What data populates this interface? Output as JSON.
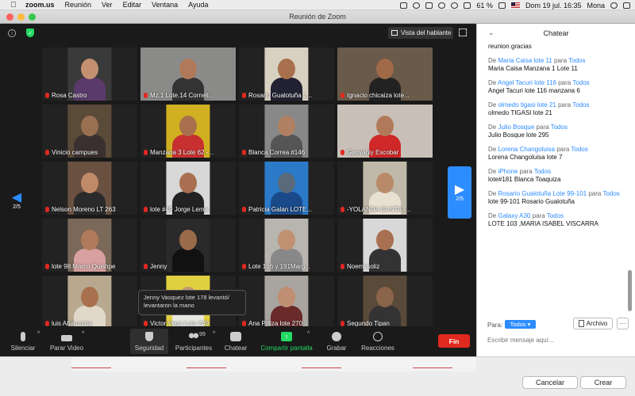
{
  "menubar": {
    "app": "zoom.us",
    "items": [
      "Reunión",
      "Ver",
      "Editar",
      "Ventana",
      "Ayuda"
    ],
    "battery": "61 %",
    "datetime": "Dom 19 jul.  16:35",
    "user": "Mona"
  },
  "window": {
    "title": "Reunión de Zoom"
  },
  "topbar": {
    "view_label": "Vista del hablante"
  },
  "page_indicator": "2/5",
  "participants": [
    {
      "name": "Rosa Castro",
      "bg": "#3a3a3a",
      "skin": "#c49070",
      "shirt": "#5a3a6a"
    },
    {
      "name": "Mz.1 Lote.14 Corneli...",
      "bg": "#8a8a88",
      "skin": "#b07a5a",
      "shirt": "#333"
    },
    {
      "name": "Rosario Gualotuña L...",
      "bg": "#d8d0c0",
      "skin": "#a8704c",
      "shirt": "#223"
    },
    {
      "name": "Ignacio chicaiza lote...",
      "bg": "#6a5a4a",
      "skin": "#a06a48",
      "shirt": "#222"
    },
    {
      "name": "Vinicio campues",
      "bg": "#5a4a38",
      "skin": "#9a7052",
      "shirt": "#3a3030"
    },
    {
      "name": "Manzana 3 Lote 62 -...",
      "bg": "#d0b020",
      "skin": "#a8704c",
      "shirt": "#c83030"
    },
    {
      "name": "Blanca Correa #146",
      "bg": "#888",
      "skin": "#b08062",
      "shirt": "#555"
    },
    {
      "name": "Geovaniy Escobar",
      "bg": "#c8c0b8",
      "skin": "#b07a5a",
      "shirt": "#d02828"
    },
    {
      "name": "Nelson Moreno LT 263",
      "bg": "#6a5040",
      "skin": "#c08a68",
      "shirt": "#2a2a2a"
    },
    {
      "name": "lote #49 Jorge Lema",
      "bg": "#d8d8d8",
      "skin": "#a87050",
      "shirt": "#222"
    },
    {
      "name": "Patricia Galan LOTE...",
      "bg": "#2a7ac8",
      "skin": "#5a6a7a",
      "shirt": "#1a4a8a"
    },
    {
      "name": "-YOLANDA SUNTA -...",
      "bg": "#c0b8a8",
      "skin": "#b88a6a",
      "shirt": "#e8e0d0"
    },
    {
      "name": "lote 98 Marco Quishpe",
      "bg": "#7a6858",
      "skin": "#b07a5a",
      "shirt": "#d8a0a0"
    },
    {
      "name": "Jenny",
      "bg": "#2a2a2a",
      "skin": "#9a6a4a",
      "shirt": "#111"
    },
    {
      "name": "Lote 166 y 191Marg...",
      "bg": "#b8b4b0",
      "skin": "#c09070",
      "shirt": "#888"
    },
    {
      "name": "Noemi soliz",
      "bg": "#d8d8d8",
      "skin": "#a87050",
      "shirt": "#333"
    },
    {
      "name": "luis Añarumba",
      "bg": "#b8a890",
      "skin": "#a8704c",
      "shirt": "#e0d8c8"
    },
    {
      "name": "Victor Vega Lote 249",
      "bg": "#e0d040",
      "skin": "#c09878",
      "shirt": "#e8e8e0"
    },
    {
      "name": "Ana Pilliza lote 270",
      "bg": "#a8a4a0",
      "skin": "#c08e72",
      "shirt": "#6a2a2a"
    },
    {
      "name": "Segundo Tipan",
      "bg": "#5a4a3a",
      "skin": "#8a6448",
      "shirt": "#333"
    }
  ],
  "tooltip": "Jenny Vasquez lote 178 levantó/ levantaron la mano",
  "toolbar": {
    "mute": "Silenciar",
    "video": "Parar Video",
    "security": "Seguridad",
    "participants": "Participantes",
    "participant_count": "99",
    "chat": "Chatear",
    "share": "Compartir pantalla",
    "record": "Grabar",
    "reactions": "Reacciones",
    "end": "Fin"
  },
  "chat": {
    "title": "Chatear",
    "first_line": "reunion gracias",
    "messages": [
      {
        "sender": "Maria Caisa lote 11",
        "to": "Todos",
        "text": "Maria Caisa Manzana 1 Lote 11"
      },
      {
        "sender": "Angel Tacuri lote 116",
        "to": "Todos",
        "text": "Angel Tacuri lote 116 manzana 6"
      },
      {
        "sender": "olmedo tigasi lote 21",
        "to": "Todos",
        "text": "olmedo TIGASI lote 21"
      },
      {
        "sender": "Julio Bosque",
        "to": "Todos",
        "text": "Julio Bosque lote 295"
      },
      {
        "sender": "Lorena Changoluisa",
        "to": "Todos",
        "text": "Lorena Changoluisa lote 7"
      },
      {
        "sender": "iPhone",
        "to": "Todos",
        "text": "lote#181 Blanca Toaquiza"
      },
      {
        "sender": "Rosario Gualotuña Lote 99-101",
        "to": "Todos",
        "text": "lote 99-101 Rosario Gualotuña"
      },
      {
        "sender": "Galaxy A30",
        "to": "Todos",
        "text": "LOTE 103 ,MARIA ISABEL VISCARRA"
      }
    ],
    "de": "De",
    "para": "para",
    "to_label": "Para:",
    "to_value": "Todos",
    "file_button": "Archivo",
    "input_placeholder": "Escribir mensaje aquí..."
  },
  "dialog": {
    "cancel": "Cancelar",
    "create": "Crear"
  },
  "colors": {
    "accent": "#2d8cff",
    "end": "#e0291f",
    "share": "#23d962"
  }
}
